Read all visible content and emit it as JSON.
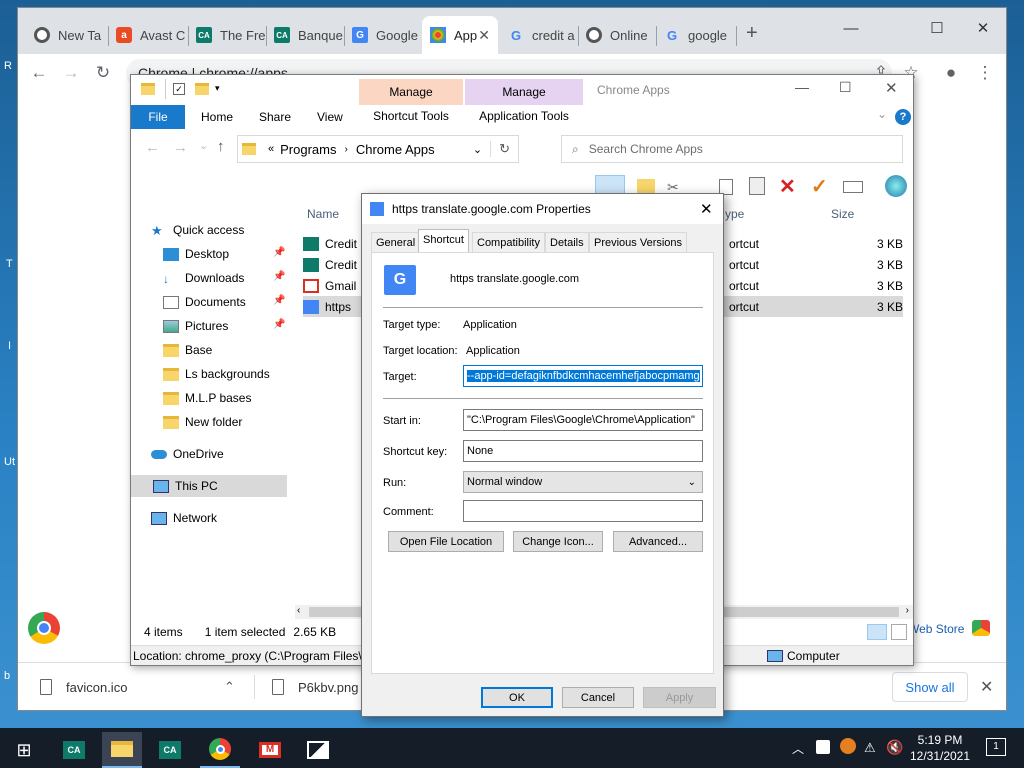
{
  "desktop": {
    "fragments": [
      "R",
      "T",
      "I",
      "Ut",
      "b"
    ]
  },
  "chrome": {
    "tabs": [
      {
        "label": "New Ta",
        "icon": "chrome-icon"
      },
      {
        "label": "Avast C",
        "icon": "avast-icon"
      },
      {
        "label": "The Fre",
        "icon": "credit-agricole-icon"
      },
      {
        "label": "Banque",
        "icon": "credit-agricole-icon"
      },
      {
        "label": "Google",
        "icon": "google-translate-icon"
      },
      {
        "label": "App",
        "icon": "apps-grid-icon"
      },
      {
        "label": "credit a",
        "icon": "google-icon"
      },
      {
        "label": "Online",
        "icon": "globe-icon"
      },
      {
        "label": "google",
        "icon": "google-icon"
      }
    ],
    "omnibox_text": "Chrome  |  chrome://apps",
    "downloads": [
      {
        "name": "favicon.ico"
      },
      {
        "name": "P6kbv.png"
      }
    ],
    "show_all": "Show all",
    "web_store": "Web Store"
  },
  "explorer": {
    "title": "Chrome Apps",
    "context_tabs": [
      {
        "head": "Manage",
        "sub": "Shortcut Tools",
        "color": "#fbd7c3"
      },
      {
        "head": "Manage",
        "sub": "Application Tools",
        "color": "#e6d3f2"
      }
    ],
    "ribbon_tabs": [
      "File",
      "Home",
      "Share",
      "View"
    ],
    "path": [
      "Programs",
      "Chrome Apps"
    ],
    "search_placeholder": "Search Chrome Apps",
    "nav": {
      "quick_access": "Quick access",
      "pinned": [
        "Desktop",
        "Downloads",
        "Documents",
        "Pictures"
      ],
      "folders": [
        "Base",
        "Ls backgrounds",
        "M.L.P bases",
        "New folder"
      ],
      "onedrive": "OneDrive",
      "this_pc": "This PC",
      "network": "Network"
    },
    "columns": {
      "name": "Name",
      "type": "ype",
      "size": "Size"
    },
    "files": [
      {
        "name": "Credit",
        "type": "ortcut",
        "size": "3 KB"
      },
      {
        "name": "Credit",
        "type": "ortcut",
        "size": "3 KB"
      },
      {
        "name": "Gmail",
        "type": "ortcut",
        "size": "3 KB"
      },
      {
        "name": "https",
        "type": "ortcut",
        "size": "3 KB"
      }
    ],
    "status": {
      "items": "4 items",
      "selected": "1 item selected",
      "size": "2.65 KB"
    },
    "location": "Location: chrome_proxy (C:\\Program Files\\",
    "computer": "Computer"
  },
  "dialog": {
    "title": "https   translate.google.com Properties",
    "tabs": [
      "General",
      "Shortcut",
      "Compatibility",
      "Details",
      "Previous Versions"
    ],
    "active_tab": "Shortcut",
    "name": "https   translate.google.com",
    "target_type_label": "Target type:",
    "target_type": "Application",
    "target_location_label": "Target location:",
    "target_location": "Application",
    "target_label": "Target:",
    "target": "--app-id=defagiknfbdkcmhacemhefjabocpmamg",
    "start_in_label": "Start in:",
    "start_in": "\"C:\\Program Files\\Google\\Chrome\\Application\"",
    "shortcut_key_label": "Shortcut key:",
    "shortcut_key": "None",
    "run_label": "Run:",
    "run": "Normal window",
    "comment_label": "Comment:",
    "comment": "",
    "buttons": [
      "Open File Location",
      "Change Icon...",
      "Advanced..."
    ],
    "footer": {
      "ok": "OK",
      "cancel": "Cancel",
      "apply": "Apply"
    }
  },
  "taskbar": {
    "time": "5:19 PM",
    "date": "12/31/2021",
    "notifications": "1"
  }
}
